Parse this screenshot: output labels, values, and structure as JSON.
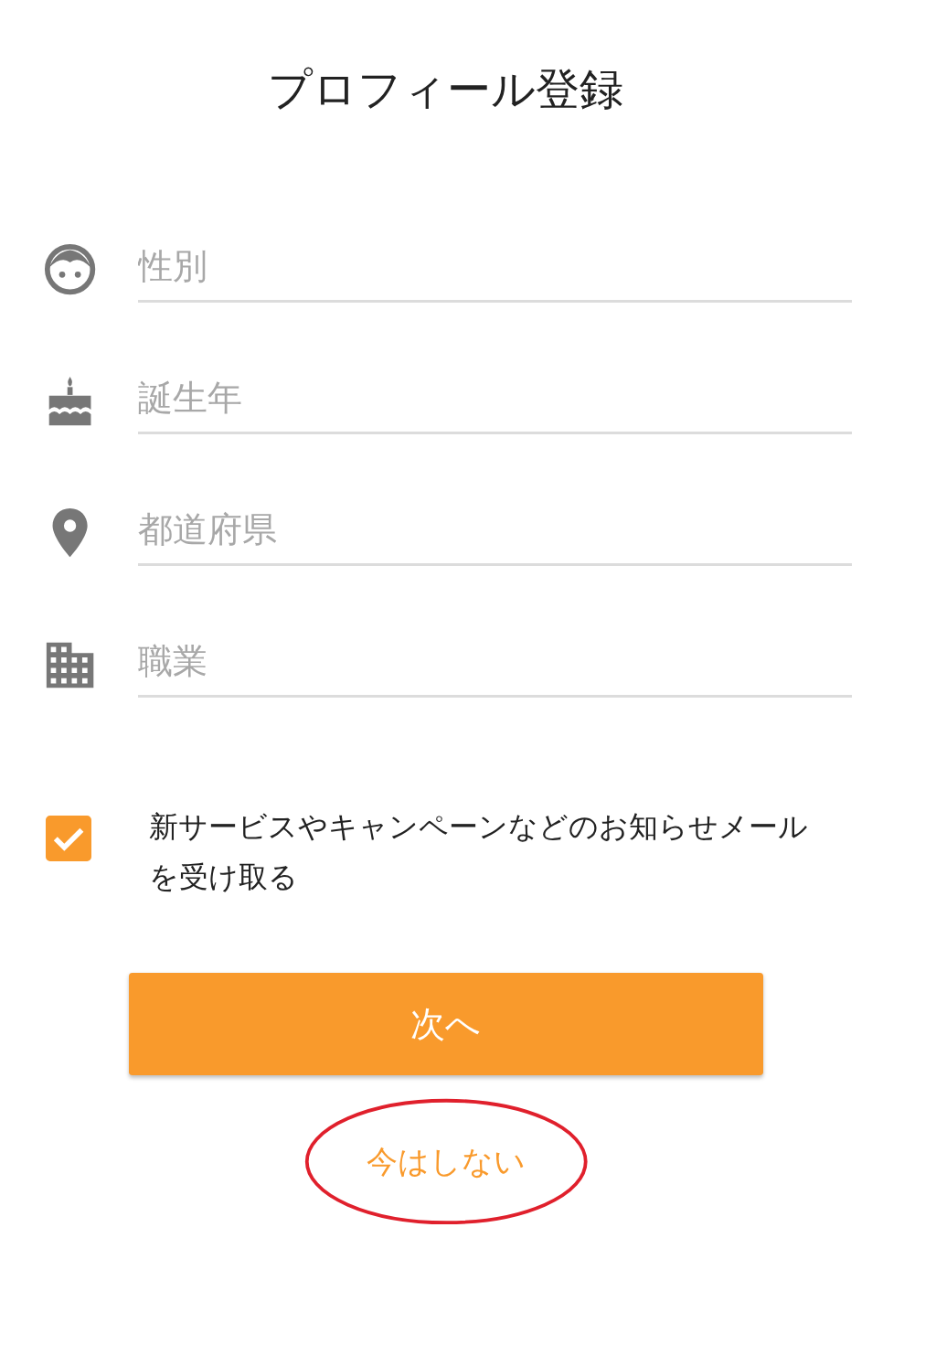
{
  "title": "プロフィール登録",
  "fields": [
    {
      "kind": "gender",
      "placeholder": "性別"
    },
    {
      "kind": "birth_year",
      "placeholder": "誕生年"
    },
    {
      "kind": "prefecture",
      "placeholder": "都道府県"
    },
    {
      "kind": "occupation",
      "placeholder": "職業"
    }
  ],
  "newsletter": {
    "checked": true,
    "label": "新サービスやキャンペーンなどのお知らせメールを受け取る"
  },
  "next_button": "次へ",
  "skip_link": {
    "label": "今はしない",
    "circled": true
  }
}
